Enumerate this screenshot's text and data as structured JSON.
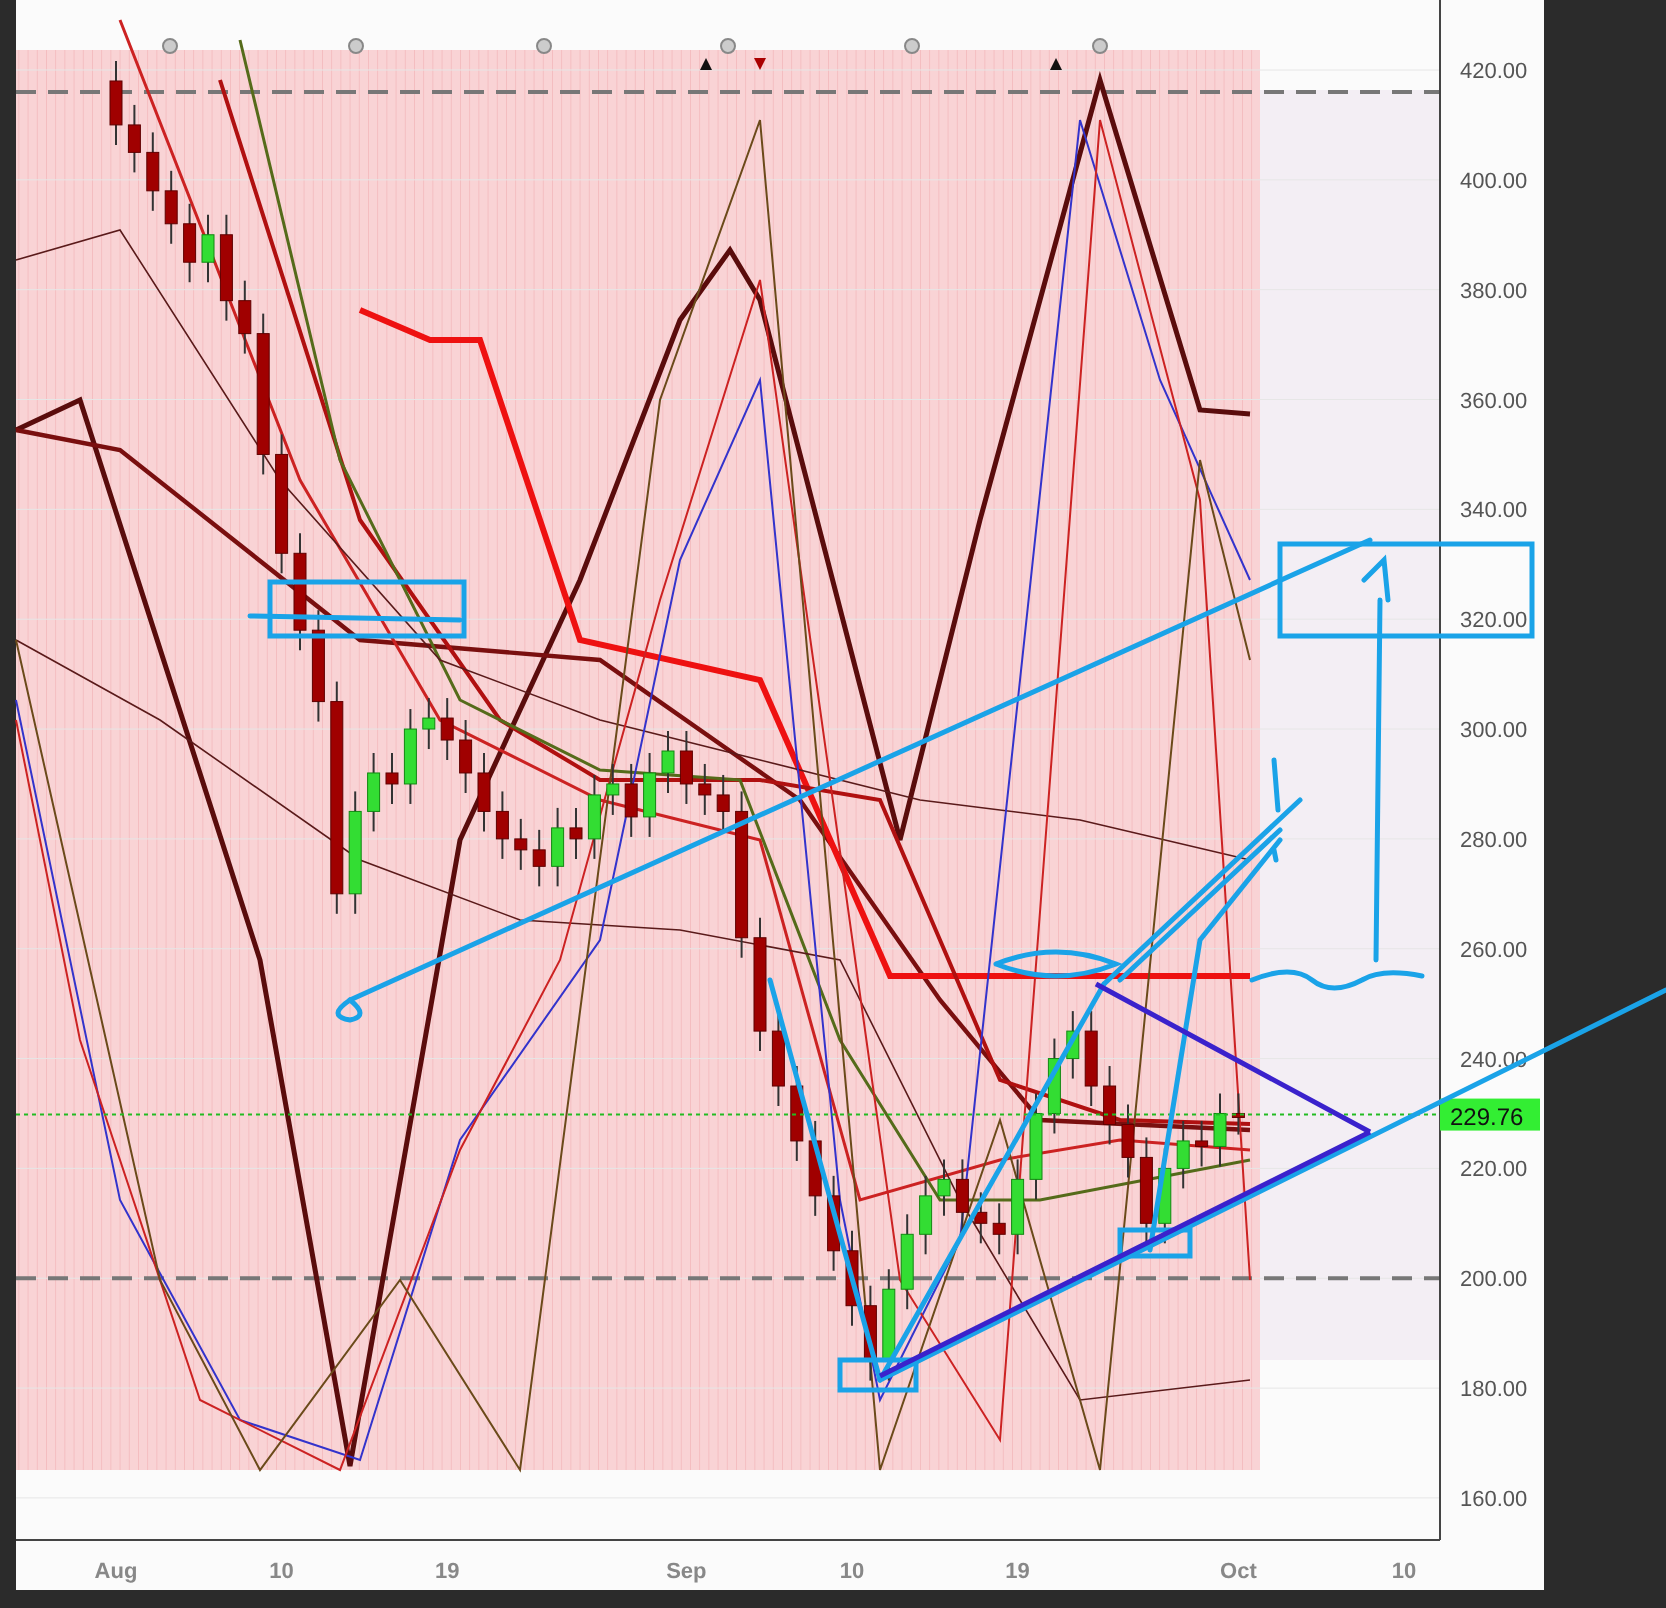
{
  "chart": {
    "y_axis_labels": [
      "420.00",
      "400.00",
      "380.00",
      "360.00",
      "340.00",
      "320.00",
      "300.00",
      "280.00",
      "260.00",
      "240.00",
      "220.00",
      "200.00",
      "180.00",
      "160.00"
    ],
    "x_axis_labels": [
      "Aug",
      "10",
      "19",
      "Sep",
      "10",
      "19",
      "Oct",
      "10"
    ],
    "price_tag": "229.76"
  }
}
